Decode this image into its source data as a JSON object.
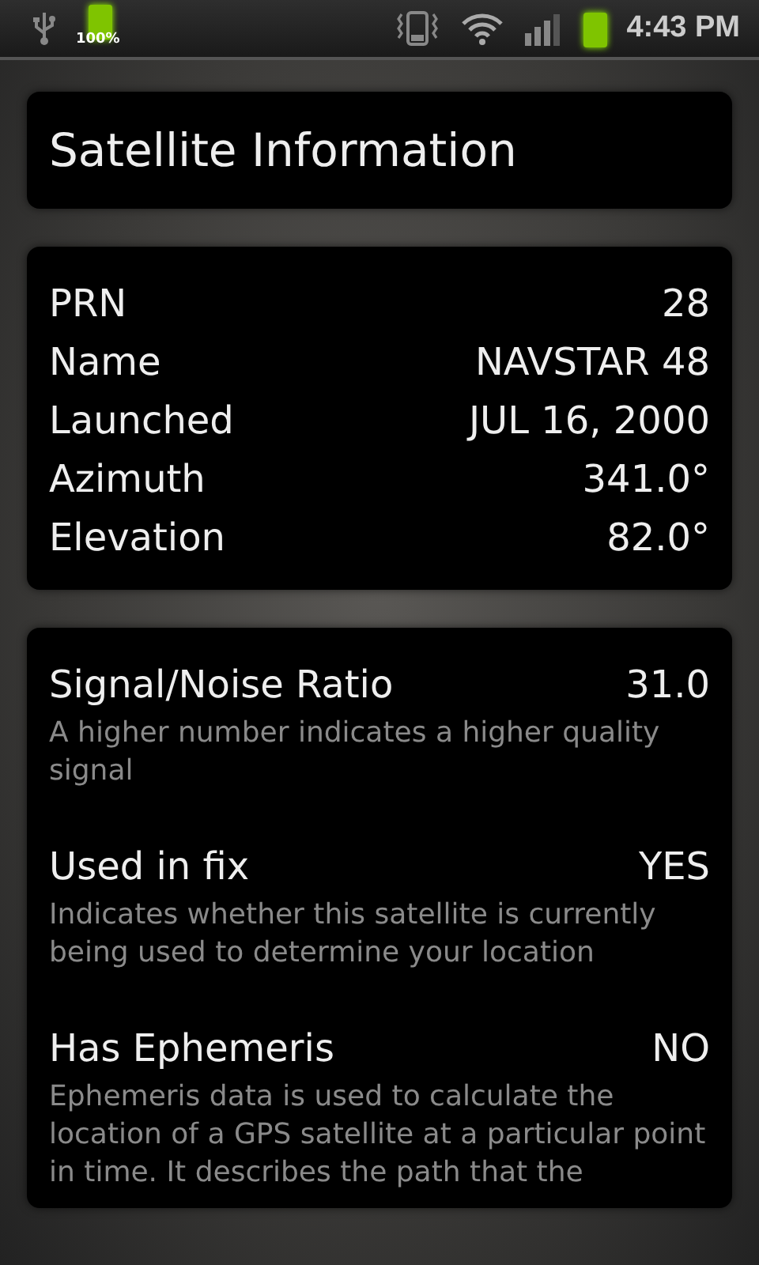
{
  "status_bar": {
    "battery_percent": "100%",
    "time": "4:43 PM"
  },
  "title": "Satellite Information",
  "details": [
    {
      "label": "PRN",
      "value": "28"
    },
    {
      "label": "Name",
      "value": "NAVSTAR 48"
    },
    {
      "label": "Launched",
      "value": "JUL 16, 2000"
    },
    {
      "label": "Azimuth",
      "value": "341.0°"
    },
    {
      "label": "Elevation",
      "value": "82.0°"
    }
  ],
  "properties": [
    {
      "label": "Signal/Noise Ratio",
      "value": "31.0",
      "description": "A higher number indicates a higher quality signal"
    },
    {
      "label": "Used in fix",
      "value": "YES",
      "description": "Indicates whether this satellite is currently being used to determine your location"
    },
    {
      "label": "Has Ephemeris",
      "value": "NO",
      "description": "Ephemeris data is used to calculate the location of a GPS satellite at a particular point in time. It describes the path that the"
    }
  ]
}
